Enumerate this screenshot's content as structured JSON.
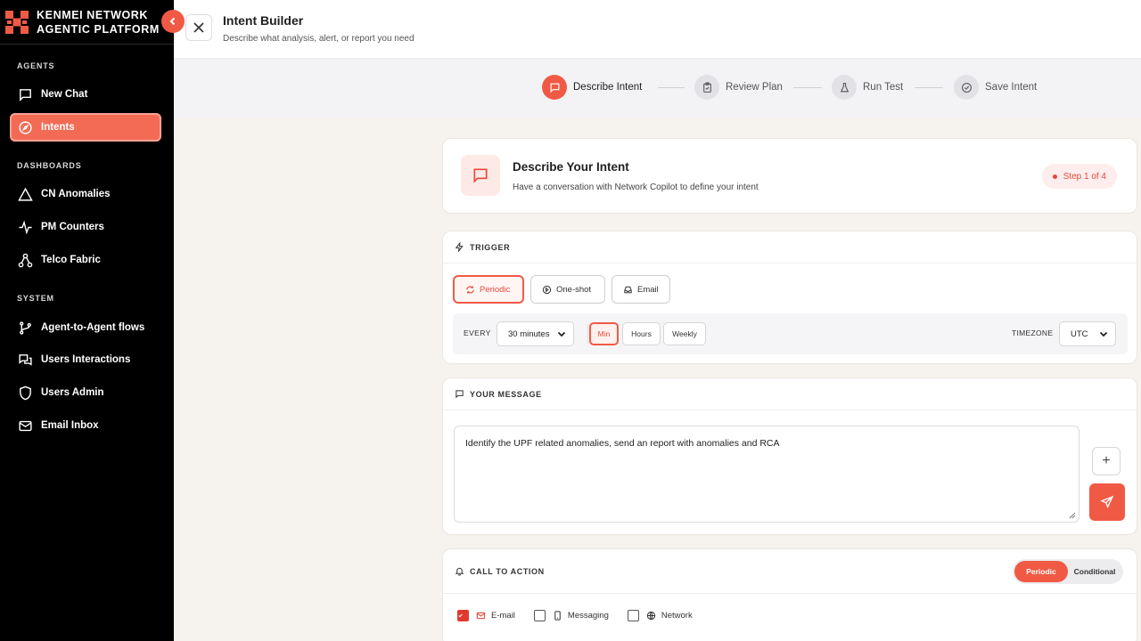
{
  "app": {
    "brand_line1": "KENMEI NETWORK",
    "brand_line2": "AGENTIC PLATFORM",
    "collapse_icon": "chevron-left-icon"
  },
  "sidebar": {
    "sections": {
      "agents": "AGENTS",
      "dashboards": "DASHBOARDS",
      "system": "SYSTEM"
    },
    "items": [
      {
        "label": "New Chat",
        "icon": "chat-icon",
        "active": false
      },
      {
        "label": "Intents",
        "icon": "compass-icon",
        "active": true
      },
      {
        "label": "CN Anomalies",
        "icon": "warning-icon",
        "active": false
      },
      {
        "label": "PM Counters",
        "icon": "pulse-icon",
        "active": false
      },
      {
        "label": "Telco Fabric",
        "icon": "network-icon",
        "active": false
      },
      {
        "label": "Agent-to-Agent flows",
        "icon": "branch-icon",
        "active": false
      },
      {
        "label": "Users Interactions",
        "icon": "messages-icon",
        "active": false
      },
      {
        "label": "Users Admin",
        "icon": "shield-icon",
        "active": false
      },
      {
        "label": "Email Inbox",
        "icon": "mail-icon",
        "active": false
      }
    ]
  },
  "header": {
    "title": "Intent Builder",
    "subtitle": "Describe what analysis, alert, or report you need"
  },
  "stepper": {
    "steps": [
      {
        "label": "Describe Intent",
        "icon": "chat-icon",
        "active": true
      },
      {
        "label": "Review Plan",
        "icon": "clipboard-icon",
        "active": false
      },
      {
        "label": "Run Test",
        "icon": "flask-icon",
        "active": false
      },
      {
        "label": "Save Intent",
        "icon": "check-circle-icon",
        "active": false
      }
    ]
  },
  "intent_card": {
    "title": "Describe Your Intent",
    "subtitle": "Have a conversation with Network Copilot to define your intent",
    "badge": "Step 1 of 4"
  },
  "trigger": {
    "heading": "TRIGGER",
    "modes": [
      {
        "label": "Periodic",
        "active": true
      },
      {
        "label": "One-shot",
        "active": false
      },
      {
        "label": "Email",
        "active": false
      }
    ],
    "every_label": "EVERY",
    "every_value": "30 minutes",
    "units": [
      {
        "label": "Min",
        "active": true
      },
      {
        "label": "Hours",
        "active": false
      },
      {
        "label": "Weekly",
        "active": false
      }
    ],
    "timezone_label": "TIMEZONE",
    "timezone_value": "UTC"
  },
  "message": {
    "heading": "YOUR MESSAGE",
    "text": "Identify the UPF related anomalies, send an report with anomalies and RCA",
    "add_label": "+"
  },
  "cta": {
    "heading": "CALL TO ACTION",
    "toggle": [
      {
        "label": "Periodic",
        "active": true
      },
      {
        "label": "Conditional",
        "active": false
      }
    ],
    "options": [
      {
        "label": "E-mail",
        "checked": true
      },
      {
        "label": "Messaging",
        "checked": false
      },
      {
        "label": "Network",
        "checked": false
      }
    ]
  },
  "colors": {
    "accent": "#f05a45",
    "sidebar_bg": "#000000",
    "content_bg": "#f6f2ee"
  }
}
